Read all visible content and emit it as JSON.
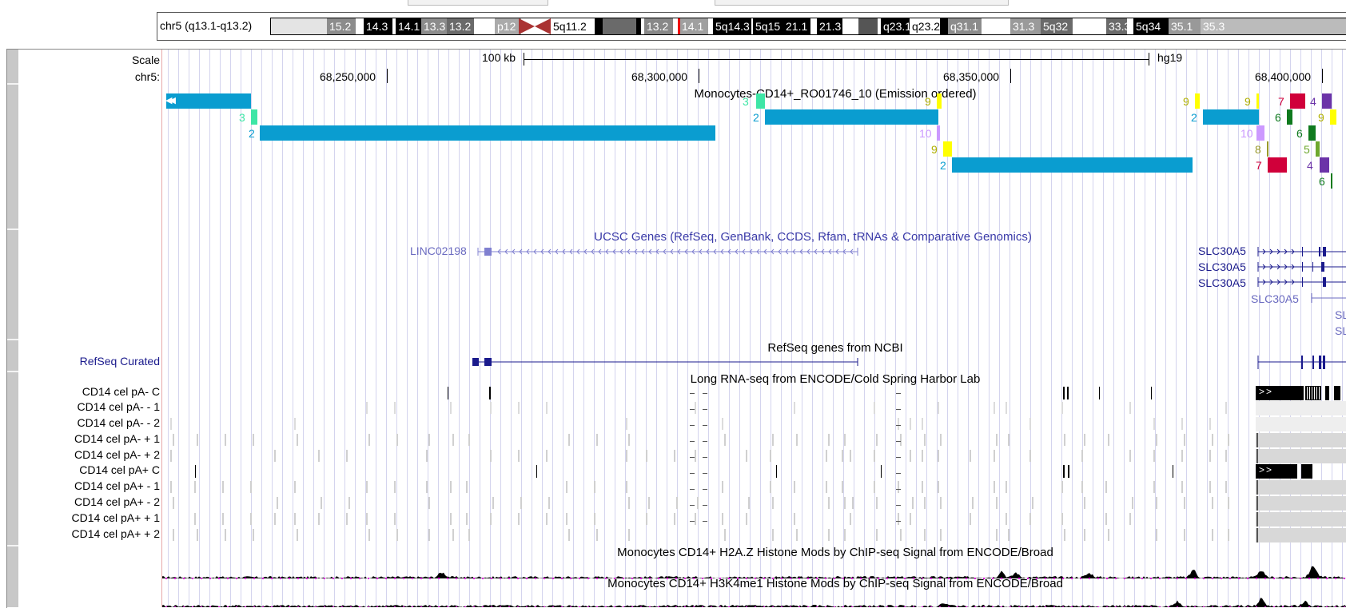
{
  "ideogram": {
    "position_label": "chr5 (q13.1-q13.2)",
    "bands": [
      "15.2",
      "14.3",
      "14.1",
      "13.3",
      "13.2",
      "p12",
      "5q11.2",
      "13.2",
      "14.1",
      "5q14.3",
      "5q15",
      "21.1",
      "21.3",
      "q23.1",
      "q23.2",
      "q31.1",
      "31.3",
      "5q32",
      "33.3",
      "5q34",
      "35.1",
      "35.3"
    ]
  },
  "ruler": {
    "scale_label": "Scale",
    "chrom_label": "chr5:",
    "scale_text": "100 kb",
    "assembly": "hg19",
    "coordinates": [
      "68,250,000",
      "68,300,000",
      "68,350,000",
      "68,400,000"
    ]
  },
  "chromhmm": {
    "title": "Monocytes-CD14+_RO01746_10 (Emission ordered)",
    "state_labels": [
      "2",
      "3",
      "2",
      "3",
      "9",
      "2",
      "10",
      "9",
      "2",
      "9",
      "9",
      "2",
      "10",
      "7",
      "6",
      "8",
      "7",
      "4",
      "6",
      "5",
      "4",
      "9",
      "6"
    ],
    "colors": {
      "2": "#0a9dd0",
      "3": "#3ee6a6",
      "9": "#ffff00",
      "10": "#cc99ff",
      "7": "#d0003a",
      "6": "#0f7a1e",
      "8": "#99992a",
      "5": "#6ea82e",
      "4": "#6b33a8"
    }
  },
  "ucsc_genes": {
    "title": "UCSC Genes (RefSeq, GenBank, CCDS, Rfam, tRNAs & Comparative Genomics)",
    "genes": [
      "LINC02198",
      "SLC30A5",
      "SLC30A5",
      "SLC30A5",
      "SLC30A5",
      "SL",
      "SL"
    ]
  },
  "refseq": {
    "track_label": "RefSeq Curated",
    "title": "RefSeq genes from NCBI"
  },
  "rnaseq": {
    "title": "Long RNA-seq from ENCODE/Cold Spring Harbor Lab",
    "subtracks": [
      "CD14 cel pA- C",
      "CD14 cel pA- - 1",
      "CD14 cel pA- - 2",
      "CD14 cel pA- + 1",
      "CD14 cel pA- + 2",
      "CD14 cel pA+ C",
      "CD14 cel pA+ - 1",
      "CD14 cel pA+ - 2",
      "CD14 cel pA+ + 1",
      "CD14 cel pA+ + 2"
    ],
    "strand_glyph": ">>"
  },
  "histone": {
    "h2az_title": "Monocytes CD14+ H2A.Z Histone Mods by ChIP-seq Signal from ENCODE/Broad",
    "h3k4me1_title": "Monocytes CD14+ H3K4me1 Histone Mods by ChIP-seq Signal from ENCODE/Broad"
  }
}
